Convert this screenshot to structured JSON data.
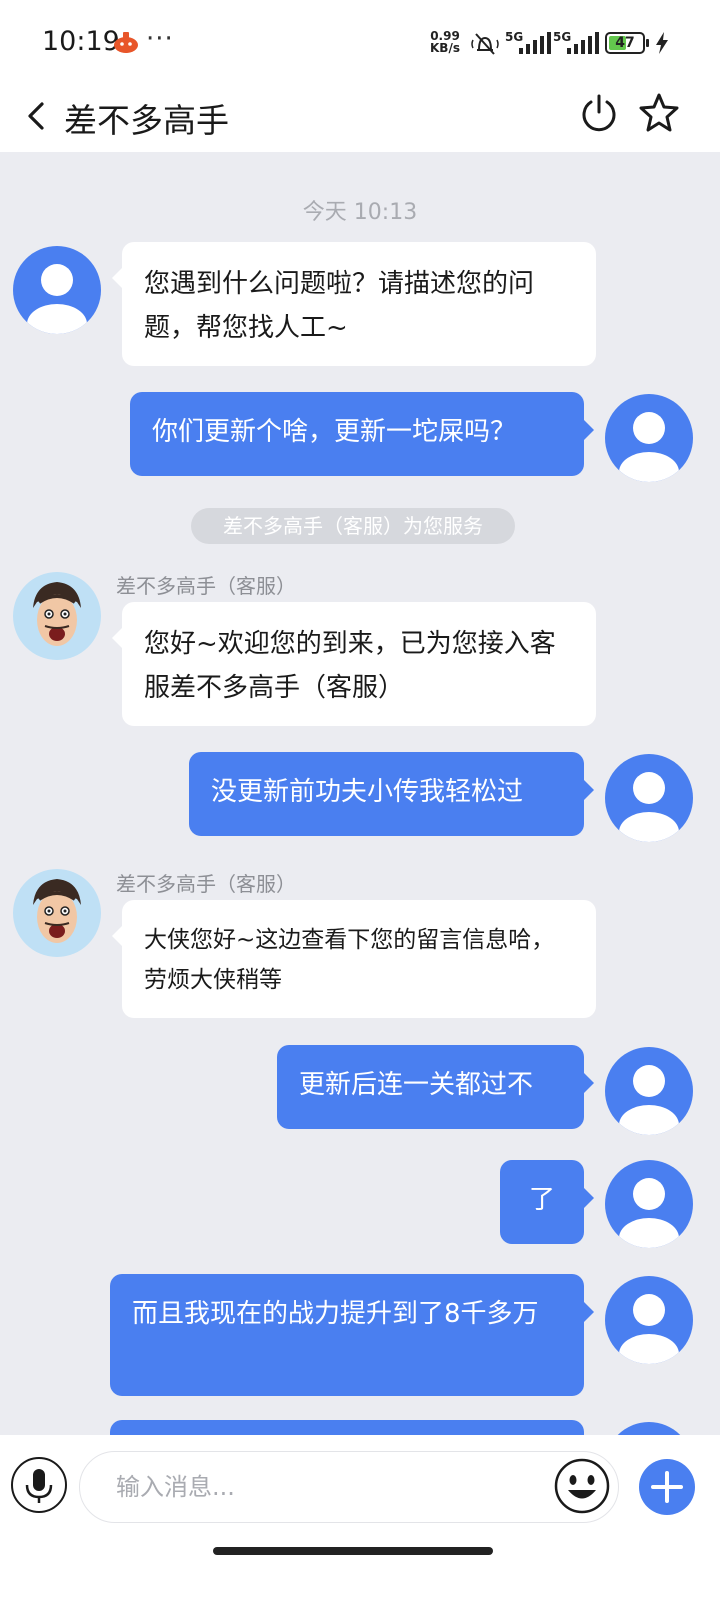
{
  "status_bar": {
    "time": "10:19",
    "more": "···",
    "net_speed_value": "0.99",
    "net_speed_unit": "KB/s",
    "signal1_label": "5G",
    "signal2_label": "5G",
    "battery": "47"
  },
  "header": {
    "title": "差不多高手",
    "icons": [
      "back-icon",
      "power-icon",
      "star-icon"
    ]
  },
  "chat": {
    "timestamp": "今天 10:13",
    "system_note": "差不多高手（客服）为您服务",
    "messages": [
      {
        "from": "bot",
        "text": "您遇到什么问题啦？请描述您的问题，帮您找人工~"
      },
      {
        "from": "user",
        "text": "你们更新个啥，更新一坨屎吗？"
      },
      {
        "from": "agent",
        "sender": "差不多高手（客服）",
        "text": "您好~欢迎您的到来，已为您接入客服差不多高手（客服）"
      },
      {
        "from": "user",
        "text": "没更新前功夫小传我轻松过"
      },
      {
        "from": "agent",
        "sender": "差不多高手（客服）",
        "text": "大侠您好~这边查看下您的留言信息哈，劳烦大侠稍等"
      },
      {
        "from": "user",
        "text": "更新后连一关都过不"
      },
      {
        "from": "user",
        "text": "了"
      },
      {
        "from": "user",
        "text": "而且我现在的战力提升到了8千多万"
      }
    ]
  },
  "input_bar": {
    "placeholder": "输入消息..."
  },
  "colors": {
    "accent": "#4a7ff0",
    "chat_background": "#ebecf1",
    "incoming_bubble": "#ffffff"
  }
}
